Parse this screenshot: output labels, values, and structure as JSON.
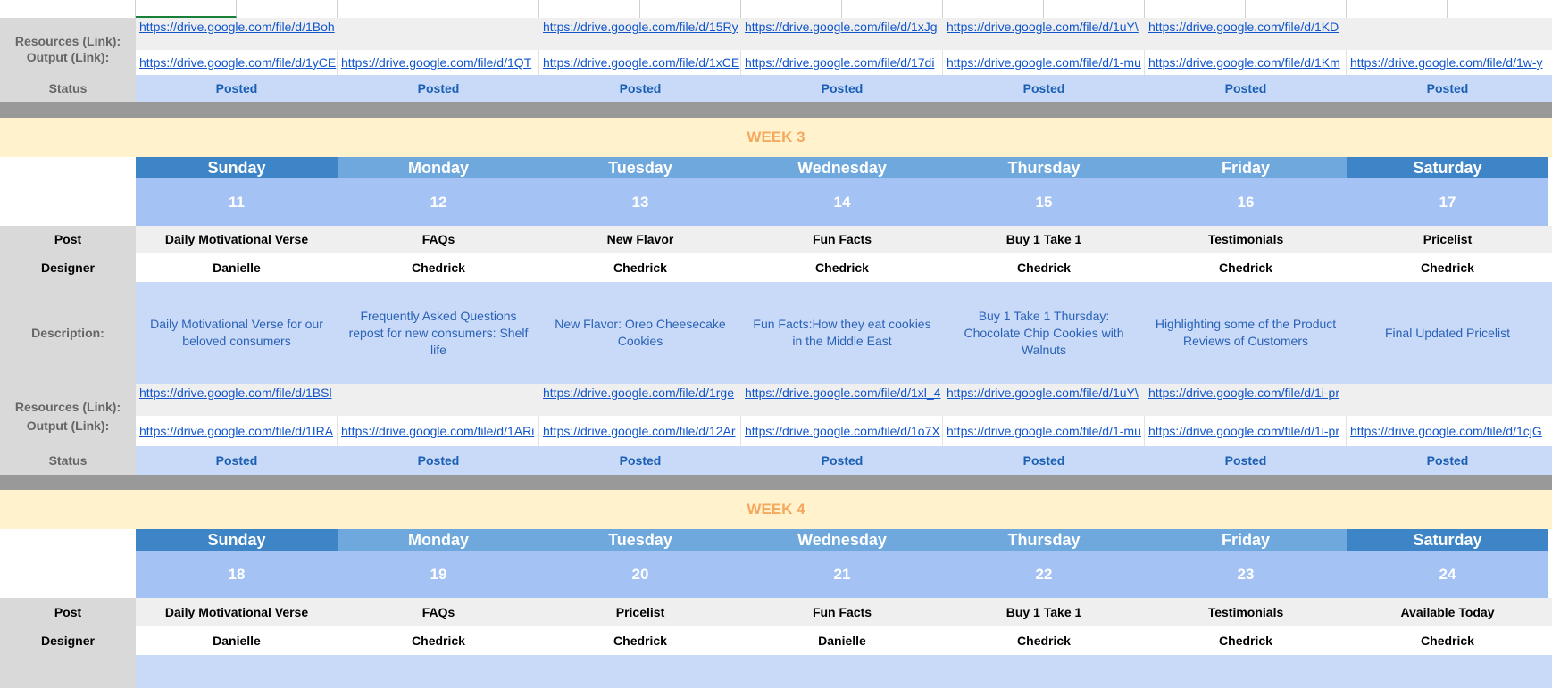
{
  "labels": {
    "resources": "Resources (Link):",
    "output": "Output (Link):",
    "status": "Status",
    "post": "Post",
    "designer": "Designer",
    "description": "Description:"
  },
  "top": {
    "resources": [
      "https://drive.google.com/file/d/1Boh",
      "",
      "https://drive.google.com/file/d/15Ry",
      "https://drive.google.com/file/d/1xJg",
      "https://drive.google.com/file/d/1uY\\",
      "https://drive.google.com/file/d/1KD",
      ""
    ],
    "output": [
      "https://drive.google.com/file/d/1yCE",
      "https://drive.google.com/file/d/1QT",
      "https://drive.google.com/file/d/1xCE",
      "https://drive.google.com/file/d/17di",
      "https://drive.google.com/file/d/1-mu",
      "https://drive.google.com/file/d/1Km",
      "https://drive.google.com/file/d/1w-y"
    ],
    "status": [
      "Posted",
      "Posted",
      "Posted",
      "Posted",
      "Posted",
      "Posted",
      "Posted"
    ]
  },
  "weeks": [
    {
      "title": "WEEK 3",
      "days": [
        "Sunday",
        "Monday",
        "Tuesday",
        "Wednesday",
        "Thursday",
        "Friday",
        "Saturday"
      ],
      "dates": [
        "11",
        "12",
        "13",
        "14",
        "15",
        "16",
        "17"
      ],
      "posts": [
        "Daily Motivational Verse",
        "FAQs",
        "New Flavor",
        "Fun Facts",
        "Buy 1 Take 1",
        "Testimonials",
        "Pricelist"
      ],
      "designers": [
        "Danielle",
        "Chedrick",
        "Chedrick",
        "Chedrick",
        "Chedrick",
        "Chedrick",
        "Chedrick"
      ],
      "descriptions": [
        "Daily Motivational Verse for our beloved consumers",
        "Frequently Asked Questions repost for new consumers: Shelf life",
        "New Flavor: Oreo Cheesecake Cookies",
        "Fun Facts:How they eat cookies in the Middle East",
        "Buy 1 Take 1 Thursday: Chocolate Chip Cookies with Walnuts",
        "Highlighting some of the Product Reviews of Customers",
        "Final Updated Pricelist"
      ],
      "resources": [
        "https://drive.google.com/file/d/1BSl",
        "",
        "https://drive.google.com/file/d/1rge",
        "https://drive.google.com/file/d/1xl_4",
        "https://drive.google.com/file/d/1uY\\",
        "https://drive.google.com/file/d/1i-pr",
        ""
      ],
      "output": [
        "https://drive.google.com/file/d/1IRA",
        "https://drive.google.com/file/d/1ARi",
        "https://drive.google.com/file/d/12Ar",
        "https://drive.google.com/file/d/1o7X",
        "https://drive.google.com/file/d/1-mu",
        "https://drive.google.com/file/d/1i-pr",
        "https://drive.google.com/file/d/1cjG"
      ],
      "status": [
        "Posted",
        "Posted",
        "Posted",
        "Posted",
        "Posted",
        "Posted",
        "Posted"
      ]
    },
    {
      "title": "WEEK 4",
      "days": [
        "Sunday",
        "Monday",
        "Tuesday",
        "Wednesday",
        "Thursday",
        "Friday",
        "Saturday"
      ],
      "dates": [
        "18",
        "19",
        "20",
        "21",
        "22",
        "23",
        "24"
      ],
      "posts": [
        "Daily Motivational Verse",
        "FAQs",
        "Pricelist",
        "Fun Facts",
        "Buy 1 Take 1",
        "Testimonials",
        "Available Today"
      ],
      "designers": [
        "Danielle",
        "Chedrick",
        "Chedrick",
        "Danielle",
        "Chedrick",
        "Chedrick",
        "Chedrick"
      ]
    }
  ],
  "colors": {
    "header_dark": "#3d85c6",
    "header_mid": "#6fa8dc",
    "date_row": "#a4c2f4",
    "light_blue": "#c9daf8",
    "week_banner": "#fff2cc",
    "week_text": "#f6a85c",
    "separator": "#999999",
    "link": "#1155cc"
  }
}
